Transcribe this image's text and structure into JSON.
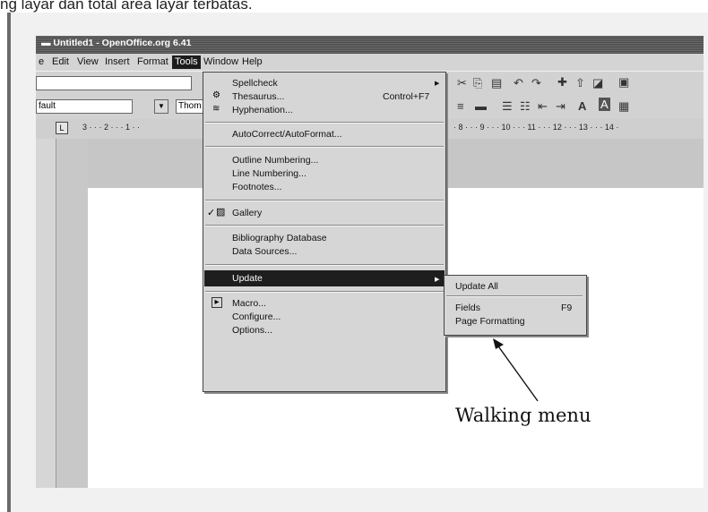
{
  "caption": "ng layar dan total area layar terbatas.",
  "window": {
    "title": "Untitled1 - OpenOffice.org 6.41"
  },
  "menubar": [
    {
      "label": "e"
    },
    {
      "label": "Edit"
    },
    {
      "label": "View"
    },
    {
      "label": "Insert"
    },
    {
      "label": "Format"
    },
    {
      "label": "Tools",
      "active": true
    },
    {
      "label": "Window"
    },
    {
      "label": "Help"
    }
  ],
  "toolbar": {
    "style_value": "fault",
    "font_value": "Thom",
    "format_glyphs": [
      "A",
      "A"
    ]
  },
  "ruler": {
    "left_ticks": "3 · · · 2 · · · 1 · ·",
    "right_ticks": "· 8 · · · 9 · · · 10 · · · 11 · · · 12 · · · 13 · · · 14 ·"
  },
  "tools_menu": {
    "items": [
      {
        "label": "Spellcheck",
        "has_submenu": true
      },
      {
        "label": "Thesaurus...",
        "shortcut": "Control+F7"
      },
      {
        "label": "Hyphenation..."
      },
      {
        "label": "AutoCorrect/AutoFormat..."
      },
      {
        "label": "Outline Numbering..."
      },
      {
        "label": "Line Numbering..."
      },
      {
        "label": "Footnotes..."
      },
      {
        "label": "Gallery",
        "checked": true
      },
      {
        "label": "Bibliography Database"
      },
      {
        "label": "Data Sources..."
      },
      {
        "label": "Update",
        "has_submenu": true,
        "highlighted": true
      },
      {
        "label": "Macro..."
      },
      {
        "label": "Configure..."
      },
      {
        "label": "Options..."
      }
    ]
  },
  "update_submenu": {
    "items": [
      {
        "label": "Update All"
      },
      {
        "label": "Fields",
        "shortcut": "F9"
      },
      {
        "label": "Page Formatting"
      }
    ]
  },
  "annotation": {
    "label": "Walking menu"
  }
}
